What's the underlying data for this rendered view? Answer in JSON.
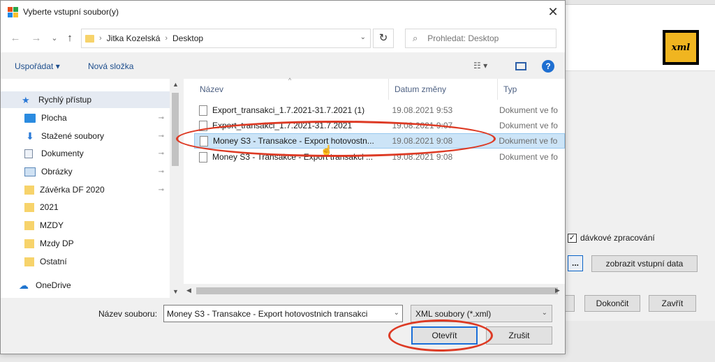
{
  "dialog": {
    "title": "Vyberte vstupní soubor(y)",
    "close_glyph": "✕"
  },
  "nav": {
    "back": "←",
    "forward": "→",
    "dropdown": "⌄",
    "up": "↑",
    "breadcrumbs": [
      "Jitka Kozelská",
      "Desktop"
    ],
    "refresh": "↻",
    "search_placeholder": "Prohledat: Desktop"
  },
  "toolbar": {
    "organize": "Uspořádat ▾",
    "new_folder": "Nová složka",
    "view": "☷ ▾",
    "help": "?"
  },
  "sidebar": {
    "items": [
      {
        "label": "Rychlý přístup",
        "icon": "star-icon",
        "pinned": false
      },
      {
        "label": "Plocha",
        "icon": "desktop-icon",
        "pinned": true
      },
      {
        "label": "Stažené soubory",
        "icon": "download-icon",
        "pinned": true
      },
      {
        "label": "Dokumenty",
        "icon": "document-icon",
        "pinned": true
      },
      {
        "label": "Obrázky",
        "icon": "picture-icon",
        "pinned": true
      },
      {
        "label": "Závěrka DF 2020",
        "icon": "folder-icon",
        "pinned": true
      },
      {
        "label": "2021",
        "icon": "folder-icon",
        "pinned": false
      },
      {
        "label": "MZDY",
        "icon": "folder-icon",
        "pinned": false
      },
      {
        "label": "Mzdy DP",
        "icon": "folder-icon",
        "pinned": false
      },
      {
        "label": "Ostatní",
        "icon": "folder-icon",
        "pinned": false
      },
      {
        "label": "OneDrive",
        "icon": "cloud-icon",
        "pinned": false
      }
    ],
    "pin_glyph": "📌"
  },
  "files": {
    "headers": {
      "name": "Název",
      "date": "Datum změny",
      "type": "Typ"
    },
    "rows": [
      {
        "name": "Export_transakci_1.7.2021-31.7.2021 (1)",
        "date": "19.08.2021 9:53",
        "type": "Dokument ve fo",
        "selected": false
      },
      {
        "name": "Export_transakci_1.7.2021-31.7.2021",
        "date": "19.08.2021 9:07",
        "type": "Dokument ve fo",
        "selected": false
      },
      {
        "name": "Money S3 - Transakce - Export hotovostn...",
        "date": "19.08.2021 9:08",
        "type": "Dokument ve fo",
        "selected": true
      },
      {
        "name": "Money S3 - Transakce - Export transakci ...",
        "date": "19.08.2021 9:08",
        "type": "Dokument ve fo",
        "selected": false
      }
    ]
  },
  "bottom": {
    "filename_label": "Název souboru:",
    "filename_value": "Money S3 - Transakce - Export hotovostnich transakci",
    "filetype": "XML soubory (*.xml)",
    "open": "Otevřít",
    "cancel": "Zrušit"
  },
  "background_app": {
    "logo_text": "xml",
    "batch_label": "dávkové zpracování",
    "batch_checked": true,
    "dots": "...",
    "show_input": "zobrazit vstupní data",
    "finish": "Dokončit",
    "close": "Zavřít"
  },
  "colors": {
    "accent": "#1a6ed8",
    "selection": "#cce4f7",
    "annotation": "#dd3a24"
  }
}
